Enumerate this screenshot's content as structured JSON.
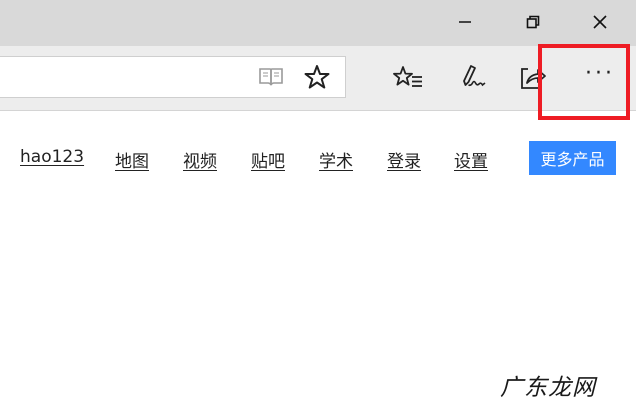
{
  "window_controls": {
    "minimize_icon": "minimize-icon",
    "restore_icon": "restore-icon",
    "close_icon": "close-icon"
  },
  "toolbar": {
    "reading_view_icon": "reading-view-icon",
    "favorite_icon": "star-icon",
    "favorites_list_icon": "favorites-list-icon",
    "web_note_icon": "pen-icon",
    "share_icon": "share-icon",
    "more_label": "···",
    "highlight_color": "#ee1c24"
  },
  "nav": {
    "links": [
      "hao123",
      "地图",
      "视频",
      "贴吧",
      "学术",
      "登录",
      "设置"
    ],
    "more_products": "更多产品",
    "more_products_color": "#3388ff"
  },
  "watermark": "广东龙网"
}
